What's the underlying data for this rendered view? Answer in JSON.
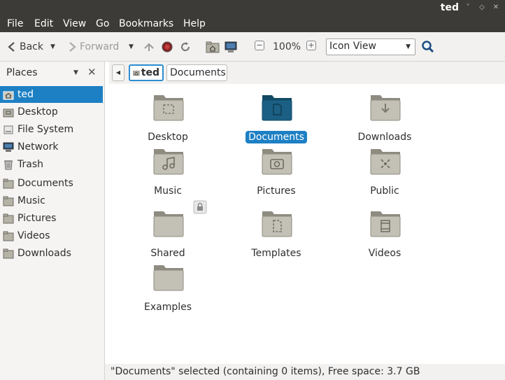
{
  "window": {
    "title": "ted"
  },
  "menu": [
    "File",
    "Edit",
    "View",
    "Go",
    "Bookmarks",
    "Help"
  ],
  "toolbar": {
    "back_label": "Back",
    "forward_label": "Forward",
    "zoom_level": "100%",
    "view_mode": "Icon View"
  },
  "sidebar": {
    "title": "Places",
    "items": [
      {
        "label": "ted",
        "icon": "home-folder-icon",
        "selected": true
      },
      {
        "label": "Desktop",
        "icon": "desktop-folder-icon"
      },
      {
        "label": "File System",
        "icon": "drive-icon"
      },
      {
        "label": "Network",
        "icon": "network-icon"
      },
      {
        "label": "Trash",
        "icon": "trash-icon"
      },
      {
        "label": "Documents",
        "icon": "folder-icon"
      },
      {
        "label": "Music",
        "icon": "folder-icon"
      },
      {
        "label": "Pictures",
        "icon": "folder-icon"
      },
      {
        "label": "Videos",
        "icon": "folder-icon"
      },
      {
        "label": "Downloads",
        "icon": "folder-icon"
      }
    ]
  },
  "location": {
    "crumbs": [
      "ted",
      "Documents"
    ]
  },
  "files": [
    {
      "label": "Desktop",
      "icon": "desktop-folder-icon"
    },
    {
      "label": "Documents",
      "icon": "documents-folder-icon",
      "selected": true
    },
    {
      "label": "Downloads",
      "icon": "downloads-folder-icon"
    },
    {
      "label": "Music",
      "icon": "music-folder-icon"
    },
    {
      "label": "Pictures",
      "icon": "pictures-folder-icon"
    },
    {
      "label": "Public",
      "icon": "public-folder-icon"
    },
    {
      "label": "Shared",
      "icon": "shared-folder-icon"
    },
    {
      "label": "Templates",
      "icon": "templates-folder-icon"
    },
    {
      "label": "Videos",
      "icon": "videos-folder-icon"
    },
    {
      "label": "Examples",
      "icon": "folder-icon"
    }
  ],
  "status": {
    "text": "\"Documents\" selected (containing 0 items), Free space: 3.7 GB"
  },
  "colors": {
    "selection": "#1e80c4",
    "titlebar": "#3c3b37",
    "folder": "#aaa79b",
    "folder_selected": "#1b5f84"
  }
}
